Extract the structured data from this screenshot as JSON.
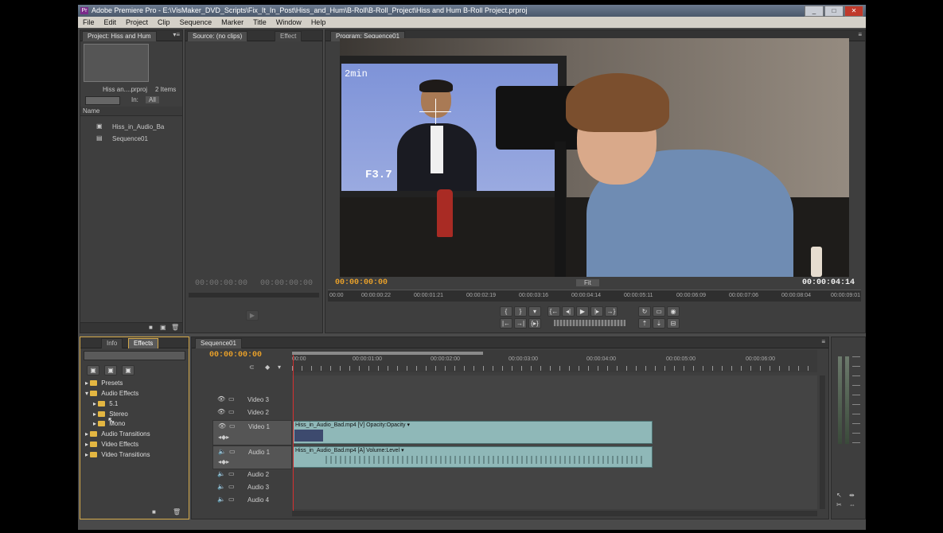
{
  "window": {
    "title": "Adobe Premiere Pro - E:\\VisMaker_DVD_Scripts\\Fix_It_In_Post\\Hiss_and_Hum\\B-Roll\\B-Roll_Project\\Hiss and Hum B-Roll Project.prproj",
    "icon_label": "Pr"
  },
  "menu": [
    "File",
    "Edit",
    "Project",
    "Clip",
    "Sequence",
    "Marker",
    "Title",
    "Window",
    "Help"
  ],
  "project_panel": {
    "tab": "Project: Hiss and Hum",
    "filename": "Hiss an....prproj",
    "item_count": "2 Items",
    "in_label": "In:",
    "in_value": "All",
    "name_header": "Name",
    "items": [
      "Hiss_in_Audio_Ba",
      "Sequence01"
    ]
  },
  "source_panel": {
    "tabs": [
      "Source: (no clips)",
      "Effect"
    ],
    "timecode_left": "00:00:00:00",
    "timecode_right": "00:00:00:00"
  },
  "program_panel": {
    "tab": "Program: Sequence01",
    "timecode_current": "00:00:00:00",
    "fit": "Fit",
    "timecode_duration": "00:00:04:14",
    "ruler": [
      "00:00",
      "00:00:00:22",
      "00:00:01:21",
      "00:00:02:19",
      "00:00:03:16",
      "00:00:04:14",
      "00:00:05:11",
      "00:00:06:09",
      "00:00:07:06",
      "00:00:08:04",
      "00:00:09:01"
    ]
  },
  "effects_panel": {
    "tabs": [
      "Info",
      "Effects"
    ],
    "tree": [
      {
        "label": "Presets",
        "level": 0
      },
      {
        "label": "Audio Effects",
        "level": 0
      },
      {
        "label": "5.1",
        "level": 1
      },
      {
        "label": "Stereo",
        "level": 1
      },
      {
        "label": "Mono",
        "level": 1
      },
      {
        "label": "Audio Transitions",
        "level": 0
      },
      {
        "label": "Video Effects",
        "level": 0
      },
      {
        "label": "Video Transitions",
        "level": 0
      }
    ]
  },
  "timeline": {
    "tab": "Sequence01",
    "timecode": "00:00:00:00",
    "ruler": [
      "00:00",
      "00:00:01:00",
      "00:00:02:00",
      "00:00:03:00",
      "00:00:04:00",
      "00:00:05:00",
      "00:00:06:00"
    ],
    "tracks": [
      "Video 3",
      "Video 2",
      "Video 1",
      "Audio 1",
      "Audio 2",
      "Audio 3",
      "Audio 4"
    ],
    "video_clip_label": "Hiss_in_Audio_Bad.mp4 [V]  Opacity:Opacity ▾",
    "audio_clip_label": "Hiss_in_Audio_Bad.mp4 [A]  Volume:Level ▾"
  },
  "video_overlay": {
    "viewfinder_text": "F3.7",
    "viewfinder_time": "2min"
  },
  "colors": {
    "accent": "#e8a02a",
    "panel": "#3e3e3e",
    "clip": "#8fb8b8"
  }
}
